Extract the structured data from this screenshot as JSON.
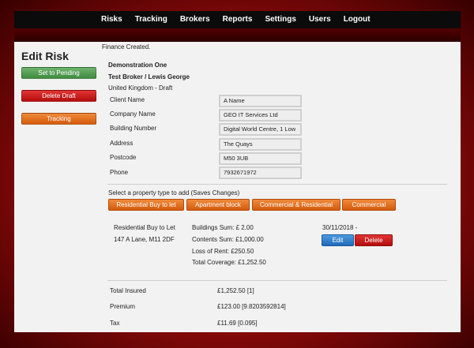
{
  "nav": {
    "items": [
      "Risks",
      "Tracking",
      "Brokers",
      "Reports",
      "Settings",
      "Users",
      "Logout"
    ]
  },
  "sidebar": {
    "title": "Edit Risk",
    "set_pending": "Set to Pending",
    "delete_draft": "Delete Draft",
    "tracking": "Tracking"
  },
  "main": {
    "flash": "Finance Created.",
    "risk_name": "Demonstration One",
    "broker_line": "Test Broker / Lewis George",
    "status_line": "United Kingdom - Draft",
    "fields": [
      {
        "label": "Client Name",
        "value": "A Name"
      },
      {
        "label": "Company Name",
        "value": "GEO IT Services Ltd"
      },
      {
        "label": "Building Number",
        "value": "Digital World Centre, 1 Low"
      },
      {
        "label": "Address",
        "value": "The Quays"
      },
      {
        "label": "Postcode",
        "value": "M50 3UB"
      },
      {
        "label": "Phone",
        "value": "7932671972"
      }
    ],
    "property_prompt": "Select a property type to add (Saves Changes)",
    "property_types": [
      "Residential Buy to let",
      "Apartment block",
      "Commercial & Residential",
      "Commercial"
    ],
    "property": {
      "type": "Residential Buy to Let",
      "address": "147 A Lane, M11 2DF",
      "buildings_sum": "Buildings Sum: £ 2.00",
      "contents_sum": "Contents Sum: £1,000.00",
      "loss_of_rent": "Loss of Rent: £250.50",
      "total_coverage": "Total Coverage: £1,252.50",
      "date": "30/11/2018 -",
      "edit_label": "Edit",
      "delete_label": "Delete"
    },
    "totals": [
      {
        "label": "Total Insured",
        "value": "£1,252.50 [1]"
      },
      {
        "label": "Premium",
        "value": "£123.00 [9.8203592814]"
      },
      {
        "label": "Tax",
        "value": "£11.69 [0.095]"
      }
    ]
  }
}
